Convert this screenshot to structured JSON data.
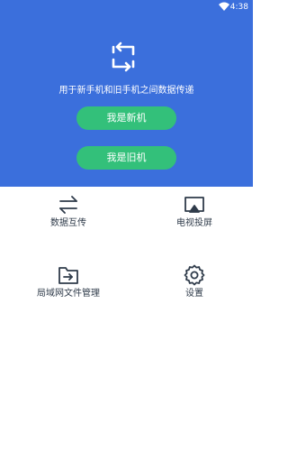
{
  "status_bar": {
    "time": "4:38",
    "wifi_icon": "wifi-icon"
  },
  "hero": {
    "icon": "phone-switch-icon",
    "tagline": "用于新手机和旧手机之间数据传递",
    "new_phone_button": "我是新机",
    "old_phone_button": "我是旧机"
  },
  "features": [
    {
      "label": "数据互传",
      "icon": "transfer-arrows-icon"
    },
    {
      "label": "电视投屏",
      "icon": "tv-cast-icon"
    },
    {
      "label": "局域网文件管理",
      "icon": "folder-arrow-icon"
    },
    {
      "label": "设置",
      "icon": "gear-icon"
    }
  ],
  "colors": {
    "primary": "#3b6fdc",
    "button_green": "#33c07a",
    "icon_dark": "#2f3b4a"
  }
}
